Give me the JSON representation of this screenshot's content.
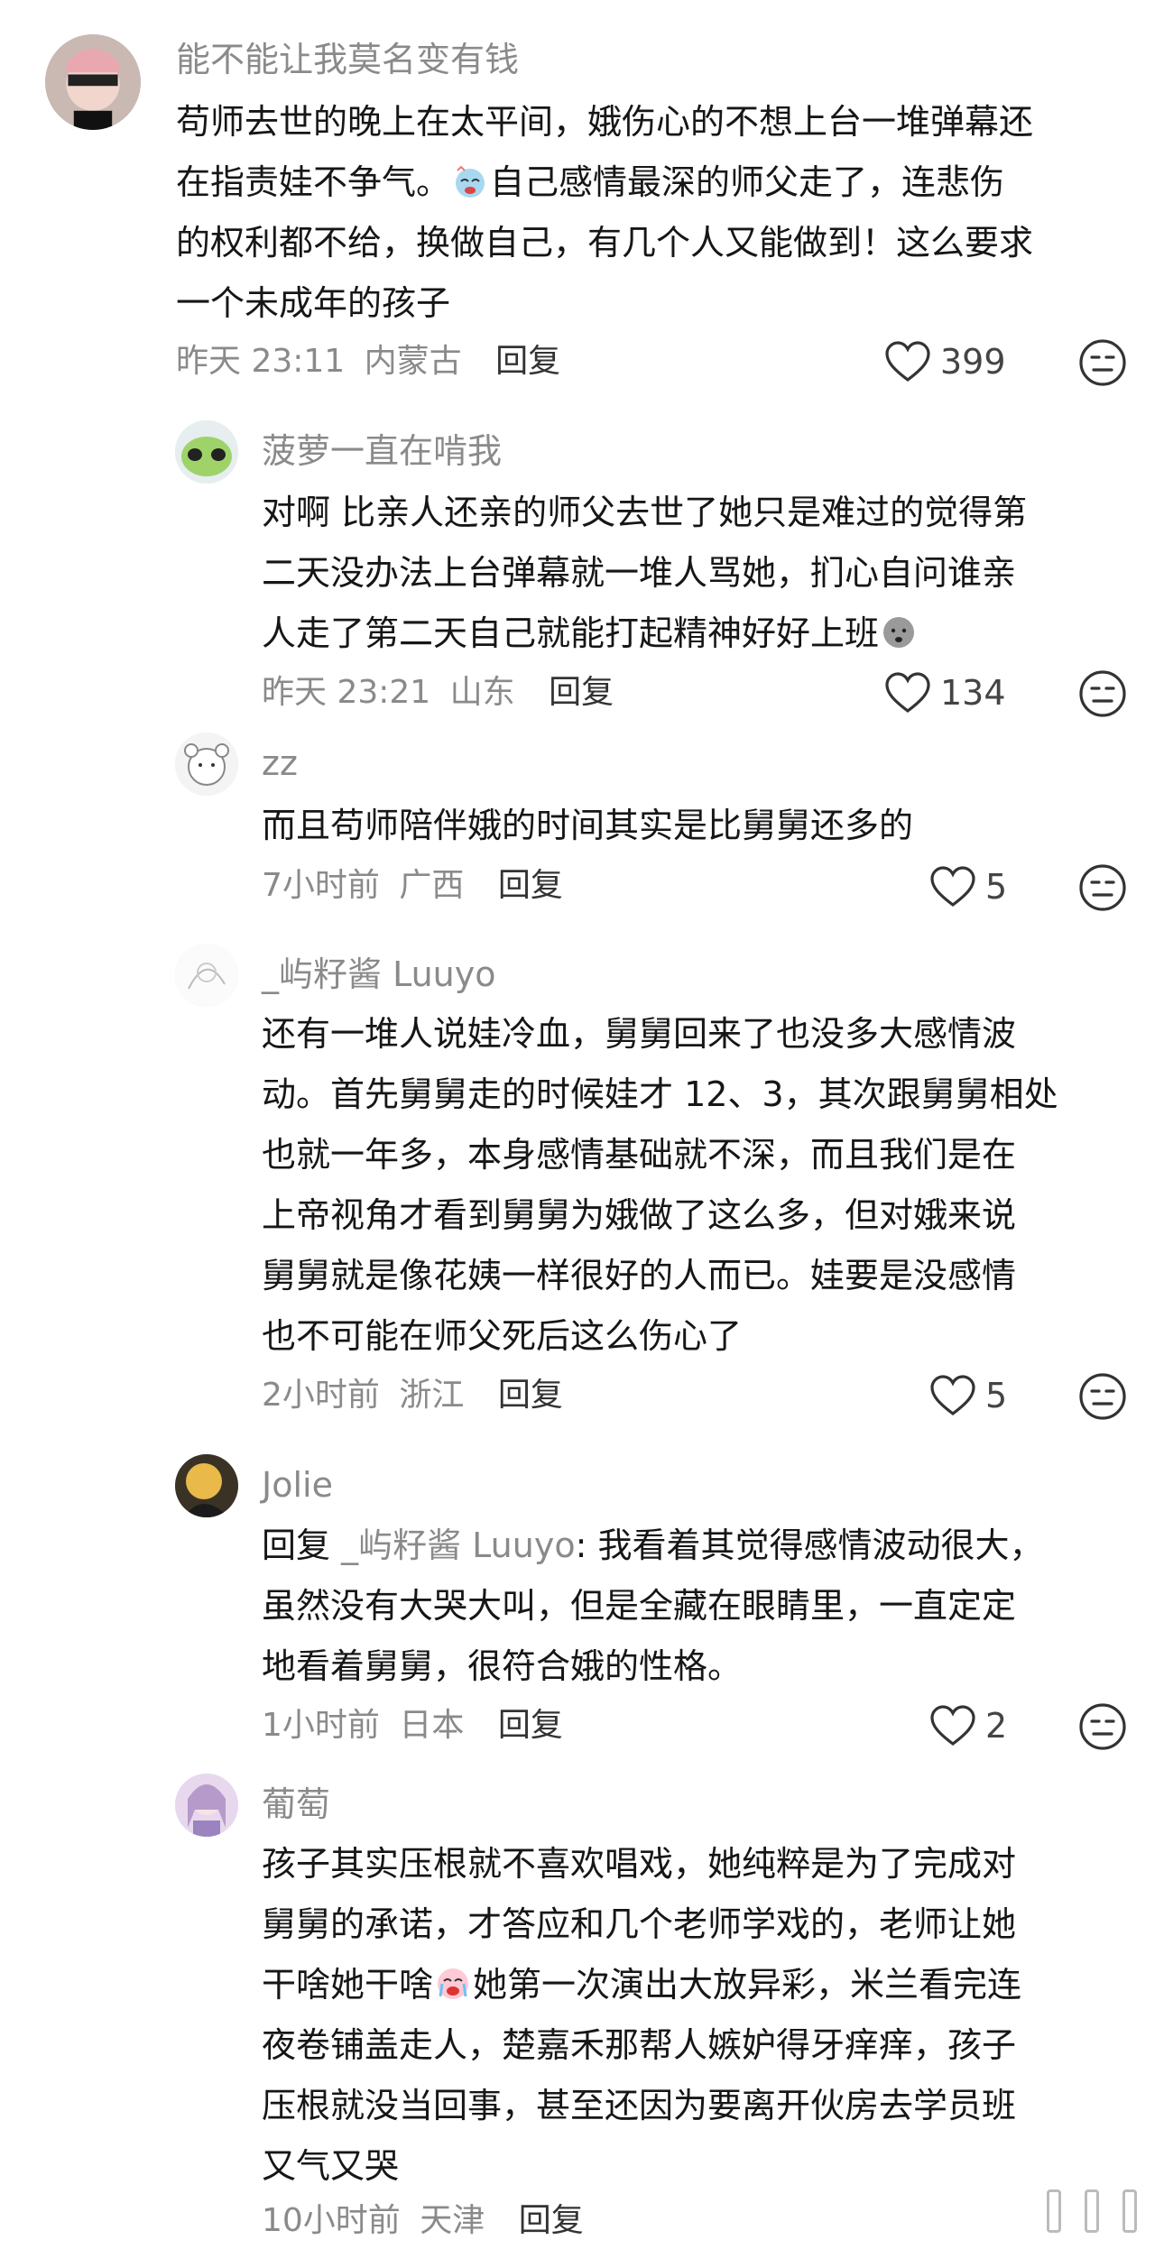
{
  "comments": [
    {
      "username": "能不能让我莫名变有钱",
      "lines": [
        "苟师去世的晚上在太平间，娥伤心的不想上台一堆弹幕还",
        "在指责娃不争气。",
        "自己感情最深的师父走了，连悲伤",
        "的权利都不给，换做自己，有几个人又能做到！这么要求",
        "一个未成年的孩子"
      ],
      "time": "昨天 23:11",
      "location": "内蒙古",
      "reply_label": "回复",
      "likes": "399"
    },
    {
      "username": "菠萝一直在啃我",
      "lines": [
        "对啊 比亲人还亲的师父去世了她只是难过的觉得第",
        "二天没办法上台弹幕就一堆人骂她，扪心自问谁亲",
        "人走了第二天自己就能打起精神好好上班"
      ],
      "time": "昨天 23:21",
      "location": "山东",
      "reply_label": "回复",
      "likes": "134"
    },
    {
      "username": "zz",
      "lines": [
        "而且苟师陪伴娥的时间其实是比舅舅还多的"
      ],
      "time": "7小时前",
      "location": "广西",
      "reply_label": "回复",
      "likes": "5"
    },
    {
      "username": "_屿籽酱 Luuyo",
      "lines": [
        "还有一堆人说娃冷血，舅舅回来了也没多大感情波",
        "动。首先舅舅走的时候娃才 12、3，其次跟舅舅相处",
        "也就一年多，本身感情基础就不深，而且我们是在",
        "上帝视角才看到舅舅为娥做了这么多，但对娥来说",
        "舅舅就是像花姨一样很好的人而已。娃要是没感情",
        "也不可能在师父死后这么伤心了"
      ],
      "time": "2小时前",
      "location": "浙江",
      "reply_label": "回复",
      "likes": "5"
    },
    {
      "username": "Jolie",
      "reply_prefix": "回复 ",
      "reply_target": "_屿籽酱 Luuyo",
      "lines": [
        ": 我看着其觉得感情波动很大，",
        "虽然没有大哭大叫，但是全藏在眼睛里，一直定定",
        "地看着舅舅，很符合娥的性格。"
      ],
      "time": "1小时前",
      "location": "日本",
      "reply_label": "回复",
      "likes": "2"
    },
    {
      "username": "葡萄",
      "lines": [
        "孩子其实压根就不喜欢唱戏，她纯粹是为了完成对",
        "舅舅的承诺，才答应和几个老师学戏的，老师让她",
        "干啥她干啥",
        "她第一次演出大放异彩，米兰看完连",
        "夜卷铺盖走人，楚嘉禾那帮人嫉妒得牙痒痒，孩子",
        "压根就没当回事，甚至还因为要离开伙房去学员班",
        "又气又哭"
      ],
      "time": "10小时前",
      "location": "天津",
      "reply_label": "回复"
    }
  ],
  "icons": {
    "like": "heart-outline-icon",
    "dislike": "meh-face-icon",
    "emoji_cry": "crying-emoji-icon",
    "emoji_sigh": "sigh-emoji-icon"
  }
}
